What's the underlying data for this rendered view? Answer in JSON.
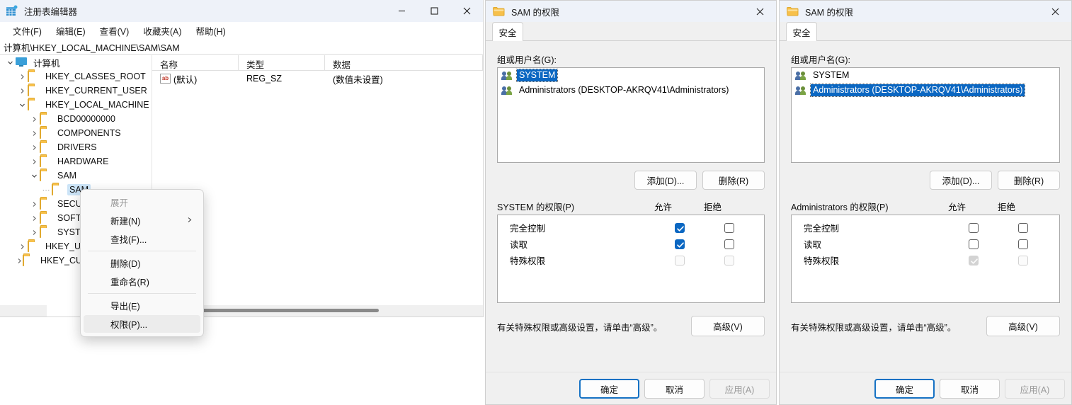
{
  "regedit": {
    "title": "注册表编辑器",
    "title_icon": "registry-icon",
    "menus": [
      {
        "label": "文件(F)"
      },
      {
        "label": "编辑(E)"
      },
      {
        "label": "查看(V)"
      },
      {
        "label": "收藏夹(A)"
      },
      {
        "label": "帮助(H)"
      }
    ],
    "window_controls": {
      "minimize": "minimize-icon",
      "maximize": "maximize-icon",
      "close": "close-icon"
    },
    "address": "计算机\\HKEY_LOCAL_MACHINE\\SAM\\SAM",
    "tree": [
      {
        "label": "计算机",
        "indent": 0,
        "chev": "down",
        "icon": "computer-icon",
        "selected": false
      },
      {
        "label": "HKEY_CLASSES_ROOT",
        "indent": 1,
        "chev": "right",
        "icon": "folder-icon",
        "selected": false
      },
      {
        "label": "HKEY_CURRENT_USER",
        "indent": 1,
        "chev": "right",
        "icon": "folder-icon",
        "selected": false
      },
      {
        "label": "HKEY_LOCAL_MACHINE",
        "indent": 1,
        "chev": "down",
        "icon": "folder-icon",
        "selected": false
      },
      {
        "label": "BCD00000000",
        "indent": 2,
        "chev": "right",
        "icon": "folder-icon",
        "selected": false
      },
      {
        "label": "COMPONENTS",
        "indent": 2,
        "chev": "right",
        "icon": "folder-icon",
        "selected": false
      },
      {
        "label": "DRIVERS",
        "indent": 2,
        "chev": "right",
        "icon": "folder-icon",
        "selected": false
      },
      {
        "label": "HARDWARE",
        "indent": 2,
        "chev": "right",
        "icon": "folder-icon",
        "selected": false
      },
      {
        "label": "SAM",
        "indent": 2,
        "chev": "down",
        "icon": "folder-icon",
        "selected": false
      },
      {
        "label": "SAM",
        "indent": 3,
        "chev": "none",
        "icon": "folder-icon",
        "selected": true
      },
      {
        "label": "SECURITY",
        "indent": 2,
        "chev": "right",
        "icon": "folder-icon",
        "selected": false
      },
      {
        "label": "SOFTWARE",
        "indent": 2,
        "chev": "right",
        "icon": "folder-icon",
        "selected": false
      },
      {
        "label": "SYSTEM",
        "indent": 2,
        "chev": "right",
        "icon": "folder-icon",
        "selected": false
      },
      {
        "label": "HKEY_USERS",
        "indent": 1,
        "chev": "right",
        "icon": "folder-icon",
        "selected": false
      },
      {
        "label": "HKEY_CURRENT_CONFIG",
        "indent": 1,
        "chev": "right",
        "icon": "folder-icon",
        "selected": false
      }
    ],
    "values": {
      "columns": [
        "名称",
        "类型",
        "数据"
      ],
      "rows": [
        {
          "name": "(默认)",
          "type": "REG_SZ",
          "data": "(数值未设置)",
          "icon": "string-value-icon"
        }
      ]
    }
  },
  "context_menu": {
    "items": [
      {
        "label": "展开",
        "disabled": true,
        "submenu": false,
        "highlighted": false
      },
      {
        "label": "新建(N)",
        "disabled": false,
        "submenu": true,
        "highlighted": false
      },
      {
        "label": "查找(F)...",
        "disabled": false,
        "submenu": false,
        "highlighted": false
      },
      {
        "separator": true
      },
      {
        "label": "删除(D)",
        "disabled": false,
        "submenu": false,
        "highlighted": false
      },
      {
        "label": "重命名(R)",
        "disabled": false,
        "submenu": false,
        "highlighted": false
      },
      {
        "separator": true
      },
      {
        "label": "导出(E)",
        "disabled": false,
        "submenu": false,
        "highlighted": false
      },
      {
        "label": "权限(P)...",
        "disabled": false,
        "submenu": false,
        "highlighted": true
      }
    ]
  },
  "dialog1": {
    "title": "SAM 的权限",
    "title_icon": "folder-icon",
    "close_icon": "close-icon",
    "tab": "安全",
    "group_label": "组或用户名(G):",
    "principals": [
      {
        "name": "SYSTEM",
        "selected": true
      },
      {
        "name": "Administrators (DESKTOP-AKRQV41\\Administrators)",
        "selected": false
      }
    ],
    "add_button": "添加(D)...",
    "remove_button": "删除(R)",
    "perm_label": "SYSTEM 的权限(P)",
    "allow_header": "允许",
    "deny_header": "拒绝",
    "permissions": [
      {
        "name": "完全控制",
        "allow": "checked",
        "deny": "unchecked"
      },
      {
        "name": "读取",
        "allow": "checked",
        "deny": "unchecked"
      },
      {
        "name": "特殊权限",
        "allow": "disabled",
        "deny": "disabled"
      }
    ],
    "hint": "有关特殊权限或高级设置，请单击“高级”。",
    "advanced_button": "高级(V)",
    "ok_button": "确定",
    "cancel_button": "取消",
    "apply_button": "应用(A)"
  },
  "dialog2": {
    "title": "SAM 的权限",
    "title_icon": "folder-icon",
    "close_icon": "close-icon",
    "tab": "安全",
    "group_label": "组或用户名(G):",
    "principals": [
      {
        "name": "SYSTEM",
        "selected": false
      },
      {
        "name": "Administrators (DESKTOP-AKRQV41\\Administrators)",
        "selected": true
      }
    ],
    "add_button": "添加(D)...",
    "remove_button": "删除(R)",
    "perm_label": "Administrators 的权限(P)",
    "allow_header": "允许",
    "deny_header": "拒绝",
    "permissions": [
      {
        "name": "完全控制",
        "allow": "unchecked",
        "deny": "unchecked"
      },
      {
        "name": "读取",
        "allow": "unchecked",
        "deny": "unchecked"
      },
      {
        "name": "特殊权限",
        "allow": "disabled-checked",
        "deny": "disabled"
      }
    ],
    "hint": "有关特殊权限或高级设置，请单击“高级”。",
    "advanced_button": "高级(V)",
    "ok_button": "确定",
    "cancel_button": "取消",
    "apply_button": "应用(A)"
  },
  "colors": {
    "selection_blue": "#0b67c2",
    "tree_selection": "#cce4f7",
    "titlebar": "#eef2f9",
    "dialog_bg": "#f0f0f0",
    "focus_border": "#1672c4"
  }
}
